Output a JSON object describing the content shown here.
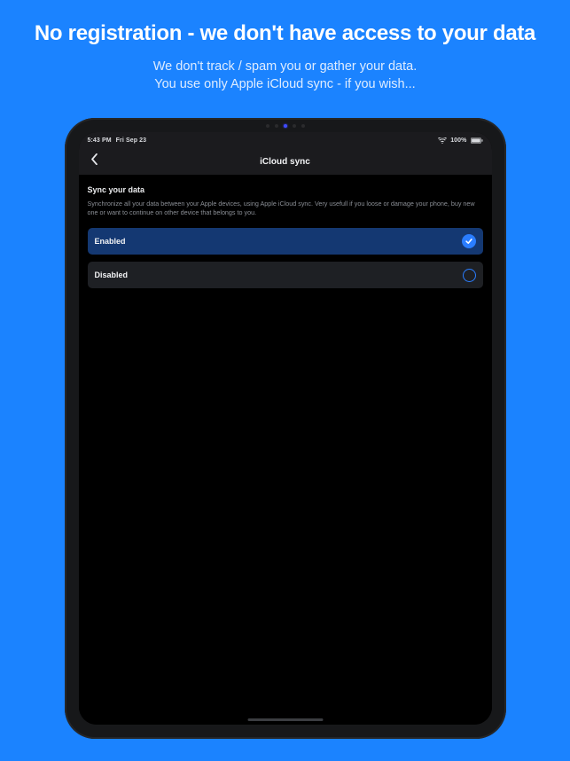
{
  "promo": {
    "headline": "No registration - we don't have access to your data",
    "sub1": "We don't track / spam you or gather your data.",
    "sub2": "You use only Apple iCloud sync - if you wish..."
  },
  "statusbar": {
    "time": "5:43 PM",
    "date": "Fri Sep 23",
    "battery_pct": "100%"
  },
  "nav": {
    "title": "iCloud sync"
  },
  "section": {
    "title": "Sync your data",
    "description": "Synchronize all your data between your Apple devices, using Apple iCloud sync. Very usefull if you loose or damage your phone, buy new one or want to continue on other device that belongs to you."
  },
  "options": {
    "enabled_label": "Enabled",
    "disabled_label": "Disabled"
  }
}
